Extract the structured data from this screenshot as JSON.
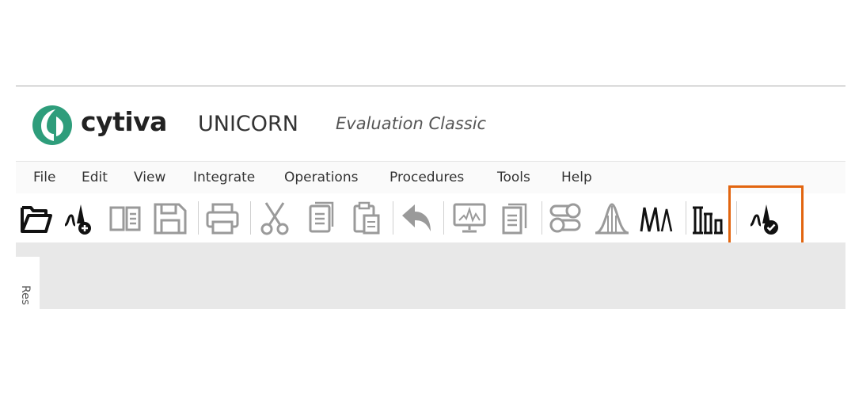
{
  "header": {
    "logo_text": "cytiva",
    "product_name": "UNICORN",
    "subtitle": "Evaluation Classic"
  },
  "menu": {
    "items": [
      "File",
      "Edit",
      "View",
      "Integrate",
      "Operations",
      "Procedures",
      "Tools",
      "Help"
    ]
  },
  "toolbar": {
    "buttons": [
      "open-folder-icon",
      "new-result-icon",
      "compare-icon",
      "save-icon",
      "print-icon",
      "cut-icon",
      "copy-icon",
      "paste-icon",
      "undo-icon",
      "monitor-icon",
      "documents-icon",
      "settings-toggle-icon",
      "peak-icon",
      "double-peak-icon",
      "columns-icon",
      "verify-result-icon"
    ],
    "highlighted": "verify-result-icon"
  },
  "side_panel": {
    "tab_label": "Res"
  },
  "colors": {
    "logo_green": "#2e9d7b",
    "icon_dark": "#111111",
    "icon_gray": "#9a9a9a",
    "highlight": "#e2650f",
    "workspace": "#e8e8e8"
  }
}
